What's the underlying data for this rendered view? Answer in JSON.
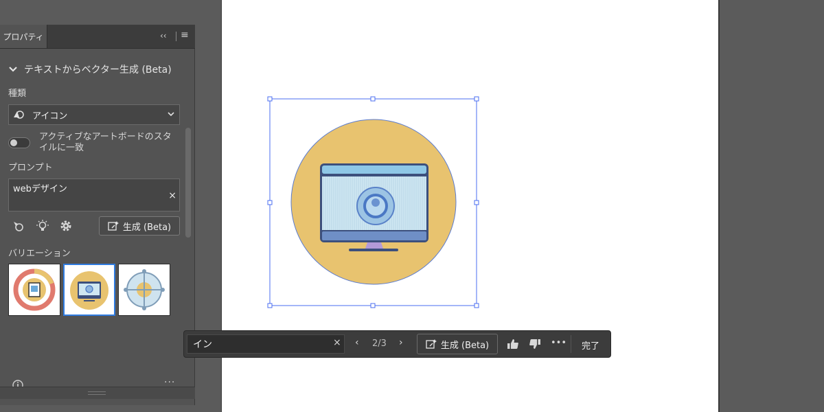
{
  "panel": {
    "tab_label": "プロパティ",
    "collapse_glyph": "‹‹",
    "section_title": "テキストからベクター生成 (Beta)",
    "type_label": "種類",
    "type_value": "アイコン",
    "toggle_label": "アクティブなアートボードのスタイルに一致",
    "prompt_label": "プロンプト",
    "prompt_value": "webデザイン",
    "clear_glyph": "×",
    "generate_label": "生成 (Beta)",
    "variations_label": "バリエーション",
    "more_glyph": "···"
  },
  "taskbar": {
    "prompt_value": "イン",
    "clear_glyph": "×",
    "prev_glyph": "‹",
    "counter": "2/3",
    "next_glyph": "›",
    "generate_label": "生成 (Beta)",
    "more_glyph": "•••",
    "done_label": "完了"
  },
  "colors": {
    "panel_bg": "#535353",
    "canvas_bg": "#ffffff",
    "selection_blue": "#4a6cf0",
    "icon_circle": "#e8c36f",
    "accent_selected": "#2f7be0"
  },
  "icons": {
    "collapse": "chevron-down-icon",
    "type": "shape-builder-icon",
    "reference": "reference-icon",
    "ideas": "lightbulb-icon",
    "settings": "gear-icon",
    "generate": "generate-sparkle-icon",
    "like": "thumbs-up-icon",
    "dislike": "thumbs-down-icon",
    "info": "info-icon"
  }
}
